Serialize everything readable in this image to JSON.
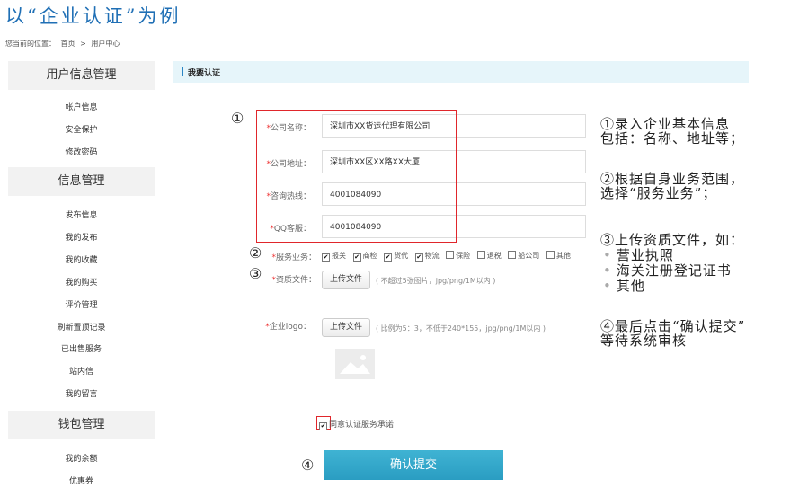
{
  "title": "以“企业认证”为例",
  "breadcrumb": [
    "您当前的位置：",
    "首页",
    ">",
    "用户中心"
  ],
  "sidebar": {
    "sections": [
      {
        "heading": "用户信息管理",
        "items": [
          "帐户信息",
          "安全保护",
          "修改密码"
        ]
      },
      {
        "heading": "信息管理",
        "items": [
          "发布信息",
          "我的发布",
          "我的收藏",
          "我的购买",
          "评价管理",
          "刷新置顶记录",
          "已出售服务",
          "站内信",
          "我的留言"
        ]
      },
      {
        "heading": "钱包管理",
        "items": [
          "我的余额",
          "优惠券"
        ]
      }
    ]
  },
  "main": {
    "section_title": "我要认证",
    "form": {
      "company_name": {
        "label": "公司名称：",
        "value": "深圳市XX货运代理有限公司"
      },
      "company_address": {
        "label": "公司地址：",
        "value": "深圳市XX区XX路XX大厦"
      },
      "hotline": {
        "label": "咨询热线：",
        "value": "4001084090"
      },
      "qq": {
        "label": "QQ客服：",
        "value": "4001084090"
      },
      "services": {
        "label": "服务业务：",
        "options": [
          {
            "name": "报关",
            "checked": true
          },
          {
            "name": "商检",
            "checked": true
          },
          {
            "name": "货代",
            "checked": true
          },
          {
            "name": "物流",
            "checked": true
          },
          {
            "name": "保险",
            "checked": false
          },
          {
            "name": "退税",
            "checked": false
          },
          {
            "name": "船公司",
            "checked": false
          },
          {
            "name": "其他",
            "checked": false
          }
        ]
      },
      "qualification": {
        "label": "资质文件：",
        "button": "上传文件",
        "hint": "( 不超过5张图片，jpg/png/1M以内 )"
      },
      "logo": {
        "label": "企业logo：",
        "button": "上传文件",
        "hint": "( 比例为5：3，不低于240*155，jpg/png/1M以内 )"
      },
      "agree": {
        "text": "同意认证服务承诺",
        "checked": true
      },
      "submit_label": "确认提交",
      "required_mark": "*"
    }
  },
  "markers": [
    "①",
    "②",
    "③",
    "④"
  ],
  "annotations": {
    "note1": [
      "①录入企业基本信息",
      "包括：名称、地址等；"
    ],
    "note2": [
      "②根据自身业务范围，",
      "选择“服务业务”；"
    ],
    "note3": [
      "③上传资质文件，如："
    ],
    "note3_bullets": [
      "营业执照",
      "海关注册登记证书",
      "其他"
    ],
    "note4": [
      "④最后点击“确认提交”",
      "等待系统审核"
    ]
  }
}
